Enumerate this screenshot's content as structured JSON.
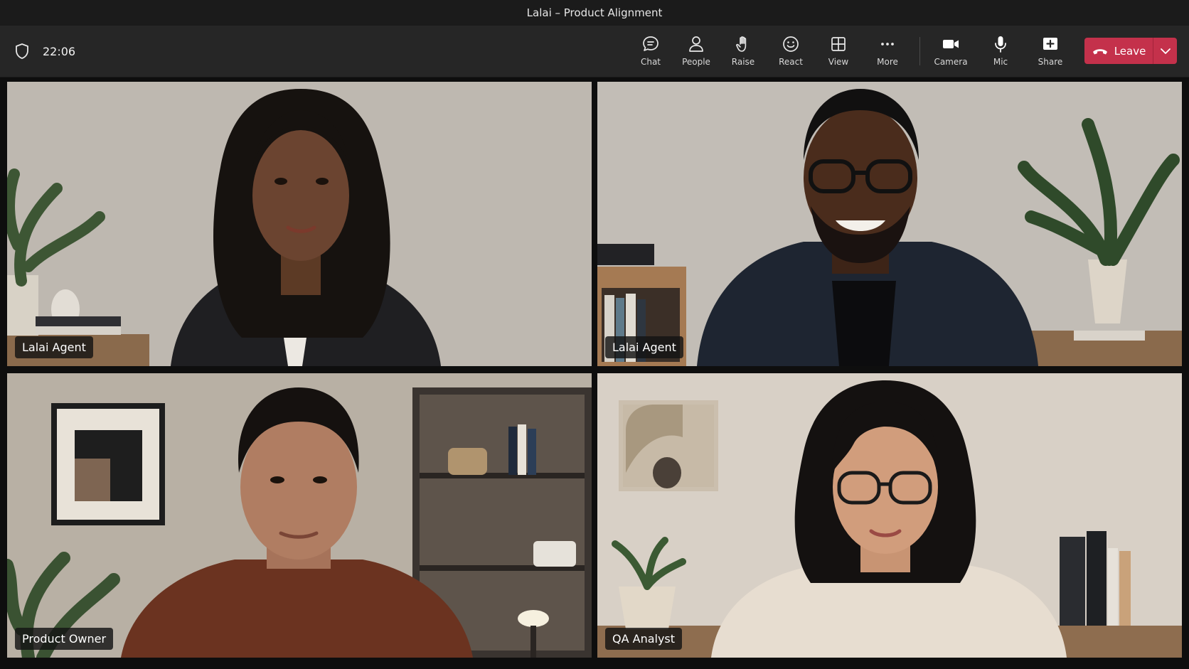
{
  "window": {
    "title": "Lalai – Product Alignment"
  },
  "toolbar": {
    "timer": "22:06",
    "buttons": [
      {
        "id": "chat",
        "label": "Chat",
        "icon": "chat-icon"
      },
      {
        "id": "people",
        "label": "People",
        "icon": "people-icon"
      },
      {
        "id": "raise",
        "label": "Raise",
        "icon": "hand-icon"
      },
      {
        "id": "react",
        "label": "React",
        "icon": "smile-icon"
      },
      {
        "id": "view",
        "label": "View",
        "icon": "grid-icon"
      },
      {
        "id": "more",
        "label": "More",
        "icon": "more-icon"
      },
      {
        "id": "camera",
        "label": "Camera",
        "icon": "camera-icon"
      },
      {
        "id": "mic",
        "label": "Mic",
        "icon": "mic-icon"
      },
      {
        "id": "share",
        "label": "Share",
        "icon": "share-icon"
      }
    ],
    "leave_label": "Leave"
  },
  "colors": {
    "leave": "#c4314b",
    "toolbar_bg": "#262626",
    "titlebar_bg": "#1b1b1b"
  },
  "participants": [
    {
      "name": "Lalai Agent"
    },
    {
      "name": "Lalai Agent"
    },
    {
      "name": "Product Owner"
    },
    {
      "name": "QA Analyst"
    }
  ]
}
